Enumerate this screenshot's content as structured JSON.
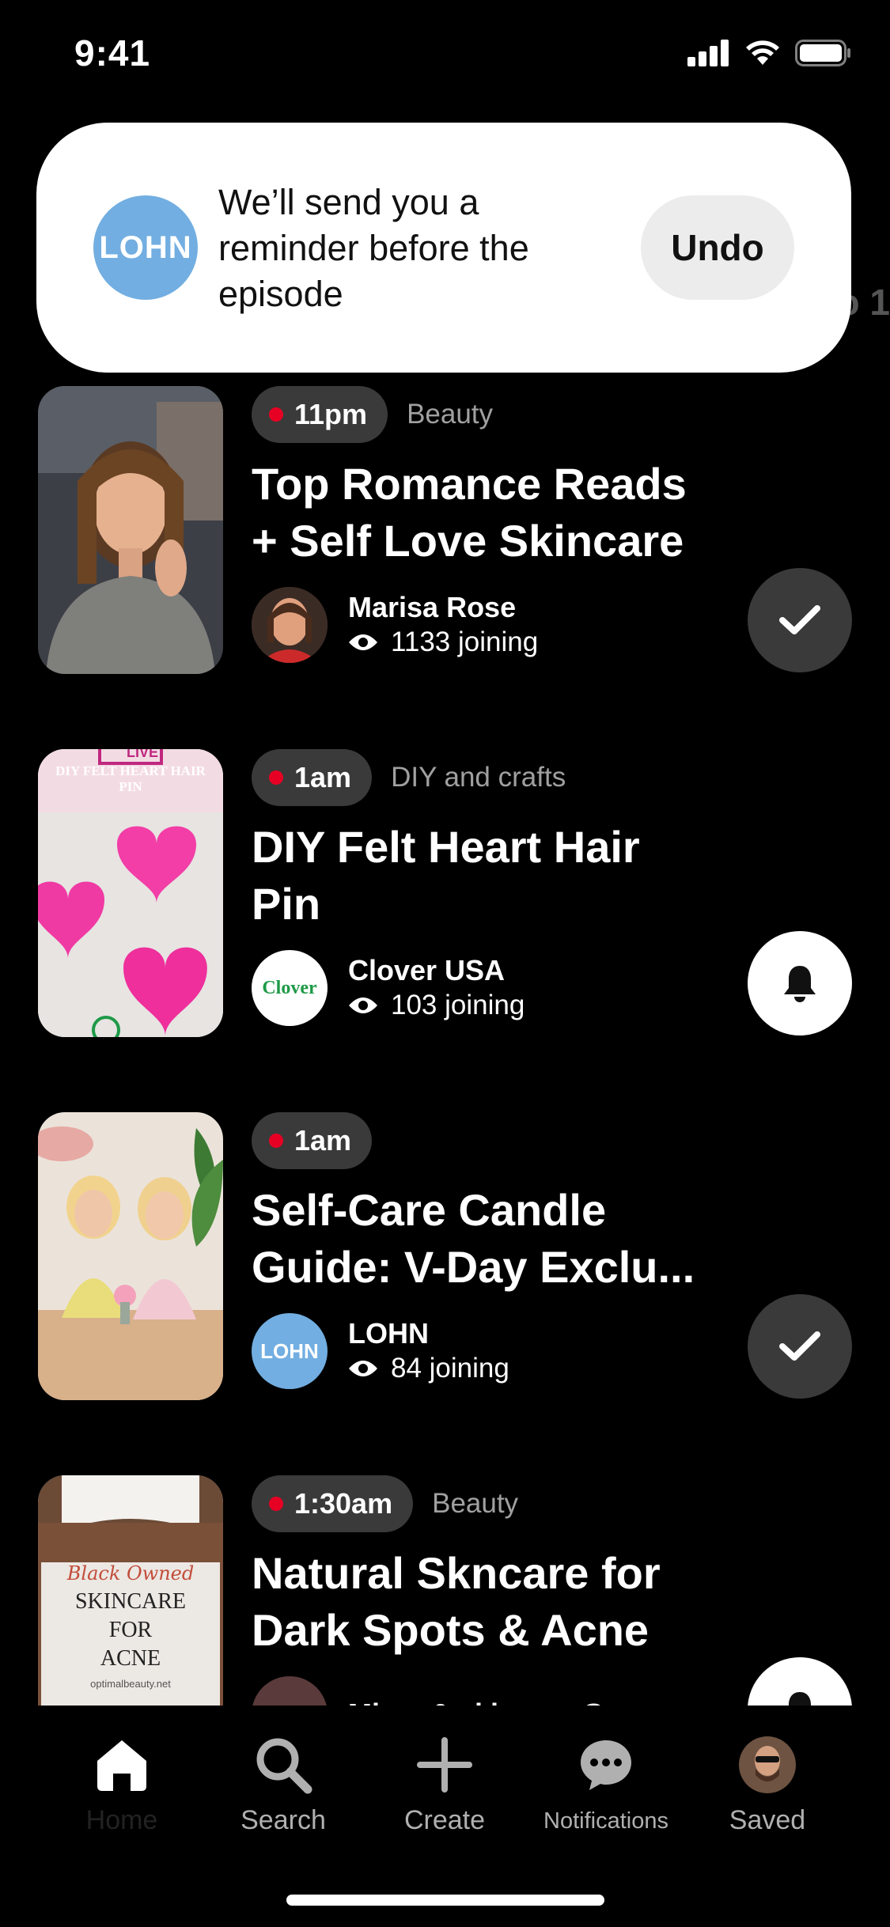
{
  "status_bar": {
    "time": "9:41"
  },
  "toast": {
    "avatar_text": "LOHN",
    "message": "We’ll send you a reminder before the episode",
    "undo_label": "Undo"
  },
  "peek_text": "o 1",
  "episodes": [
    {
      "time": "11pm",
      "category": "Beauty",
      "title": "Top Romance Reads + Self Love Skincare",
      "host": "Marisa Rose",
      "joining": "1133 joining",
      "action": "reminder-set"
    },
    {
      "time": "1am",
      "category": "DIY and crafts",
      "title": "DIY Felt Heart Hair Pin",
      "host": "Clover USA",
      "host_avatar_text": "Clover",
      "joining": "103 joining",
      "thumb_text": "DIY FELT HEART HAIR PIN",
      "thumb_live": "LIVE",
      "action": "remind-me"
    },
    {
      "time": "1am",
      "category": "",
      "title": "Self-Care Candle Guide: V-Day Exclu...",
      "host": "LOHN",
      "host_avatar_text": "LOHN",
      "joining": "84 joining",
      "action": "reminder-set"
    },
    {
      "time": "1:30am",
      "category": "Beauty",
      "title": "Natural Skncare for Dark Spots & Acne",
      "host": "Mkup & skincare Guru",
      "joining": "",
      "thumb_script": "Black Owned",
      "thumb_lines": [
        "SKINCARE",
        "FOR",
        "ACNE"
      ],
      "thumb_url": "optimalbeauty.net",
      "action": "remind-me"
    }
  ],
  "nav": {
    "home": "Home",
    "search": "Search",
    "create": "Create",
    "notifications": "Notifications",
    "saved": "Saved"
  },
  "colors": {
    "live_dot": "#e60023",
    "lohn_blue": "#72aee1",
    "pill_bg": "#3a3a3a"
  }
}
